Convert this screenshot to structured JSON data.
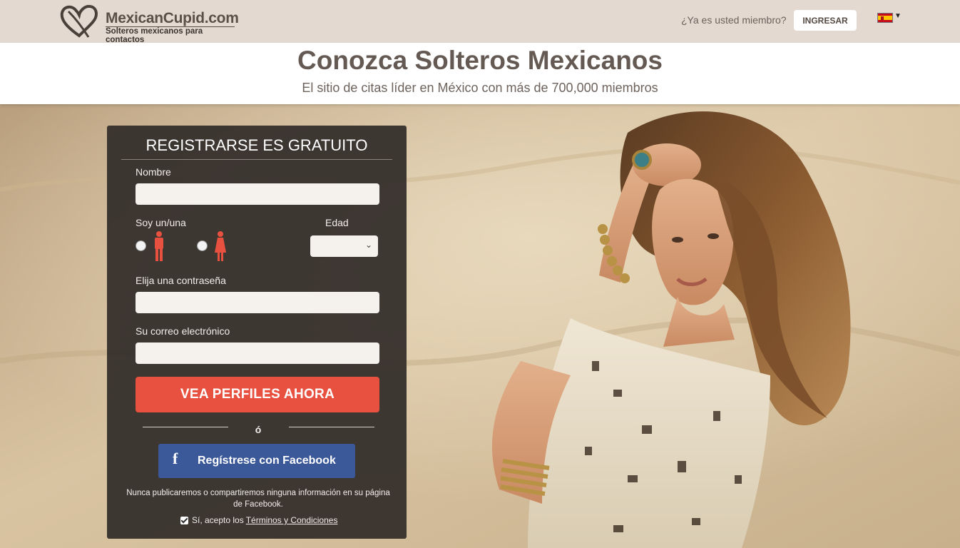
{
  "header": {
    "brand_name": "MexicanCupid.com",
    "brand_tagline": "Solteros mexicanos para contactos",
    "member_question": "¿Ya es usted miembro?",
    "login_label": "INGRESAR",
    "language_flag": "spain-flag-icon"
  },
  "hero": {
    "title": "Conozca Solteros Mexicanos",
    "subtitle": "El sitio de citas líder en México con más de 700,000 miembros"
  },
  "signup": {
    "title": "REGISTRARSE ES GRATUITO",
    "name_label": "Nombre",
    "name_value": "",
    "gender_label": "Soy un/una",
    "gender_options": [
      "male-icon",
      "female-icon"
    ],
    "age_label": "Edad",
    "age_value": "",
    "password_label": "Elija una contraseña",
    "password_value": "",
    "email_label": "Su correo electrónico",
    "email_value": "",
    "submit_label": "VEA PERFILES AHORA",
    "or_label": "ó",
    "facebook_label": "Regístrese con Facebook",
    "privacy_note": "Nunca publicaremos o compartiremos ninguna información en su página de Facebook.",
    "terms_prefix": "Sí, acepto los",
    "terms_link": "Términos y Condiciones",
    "terms_checked": true
  },
  "colors": {
    "header_bg": "#e3d9d1",
    "panel_bg": "#332e2a",
    "cta": "#e8503f",
    "facebook": "#3b5899",
    "gender_icon": "#e8503f"
  }
}
